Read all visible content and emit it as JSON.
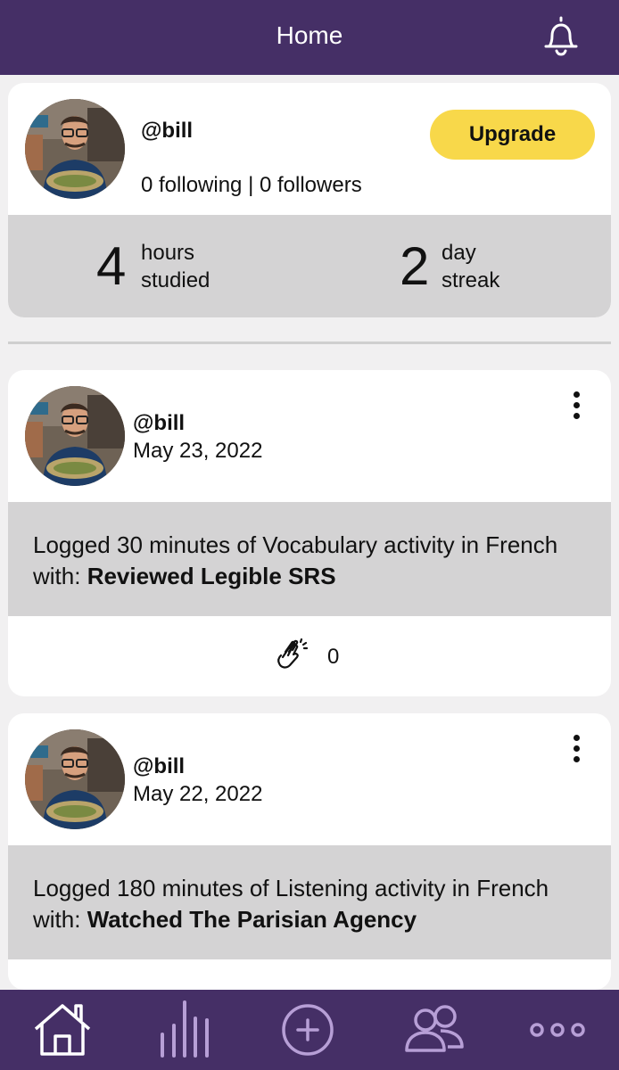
{
  "header": {
    "title": "Home",
    "icon": "bell-icon"
  },
  "profile": {
    "username": "@bill",
    "follow_text": "0 following | 0 followers",
    "upgrade_label": "Upgrade",
    "stats": [
      {
        "number": "4",
        "label_line1": "hours",
        "label_line2": "studied"
      },
      {
        "number": "2",
        "label_line1": "day",
        "label_line2": "streak"
      }
    ]
  },
  "feed": [
    {
      "username": "@bill",
      "date": "May 23, 2022",
      "text_prefix": "Logged 30 minutes of Vocabulary activity in French with: ",
      "text_bold": "Reviewed Legible SRS",
      "clap_count": "0"
    },
    {
      "username": "@bill",
      "date": "May 22, 2022",
      "text_prefix": "Logged 180 minutes of Listening activity in French with: ",
      "text_bold": "Watched The Parisian Agency"
    }
  ],
  "tabbar": {
    "items": [
      {
        "icon": "home-icon",
        "active": true
      },
      {
        "icon": "stats-icon",
        "active": false
      },
      {
        "icon": "add-circle-icon",
        "active": false
      },
      {
        "icon": "friends-icon",
        "active": false
      },
      {
        "icon": "more-icon",
        "active": false
      }
    ]
  },
  "colors": {
    "brand_purple": "#452f66",
    "accent_yellow": "#f8d84a",
    "inactive_icon": "#b79fd6"
  }
}
